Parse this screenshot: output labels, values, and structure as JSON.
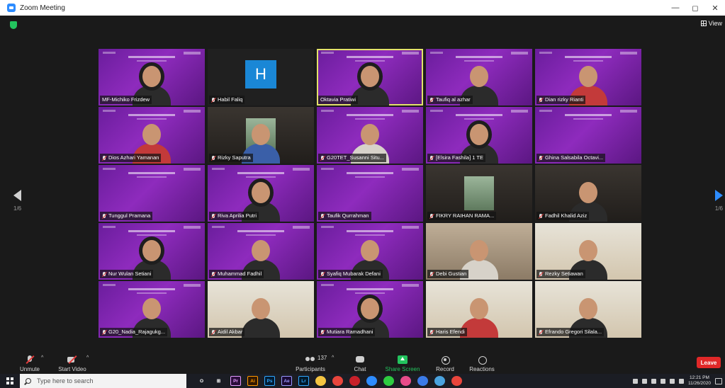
{
  "window": {
    "title": "Zoom Meeting",
    "controls": [
      "—",
      "◻",
      "✕"
    ]
  },
  "view": {
    "label": "View"
  },
  "pagination": {
    "left": "1/6",
    "right": "1/6"
  },
  "participants": [
    {
      "name": "MF-Michiko Frizdew",
      "bg": "purple",
      "person": "hijab",
      "muted": false
    },
    {
      "name": "Habil Faliq",
      "bg": "avatar",
      "avatar_letter": "H",
      "muted": true
    },
    {
      "name": "Oktavia Pratiwi",
      "bg": "purple",
      "person": "hijab",
      "muted": false,
      "speaking": true
    },
    {
      "name": "Taufiq al azhar",
      "bg": "purple",
      "person": "plain",
      "muted": true
    },
    {
      "name": "Dian rizky Rianti",
      "bg": "purple",
      "person": "red",
      "muted": true
    },
    {
      "name": "Dios Azhari Yamanan",
      "bg": "purple",
      "person": "red",
      "muted": true
    },
    {
      "name": "Rizky Saputra",
      "bg": "dark-inset",
      "person": "blue",
      "muted": true
    },
    {
      "name": "G20TET_Susanni Situ...",
      "bg": "purple",
      "person": "light",
      "muted": true
    },
    {
      "name": "[Elsira Fashila] 1 TE",
      "bg": "purple",
      "person": "hijab",
      "muted": true
    },
    {
      "name": "Ghina Salsabila Octavi...",
      "bg": "purple",
      "person": "none",
      "muted": true
    },
    {
      "name": "Tunggul Pramana",
      "bg": "purple",
      "person": "none",
      "muted": true
    },
    {
      "name": "Riva Aprilia Putri",
      "bg": "purple",
      "person": "hijab",
      "muted": true
    },
    {
      "name": "Taufik Qurrahman",
      "bg": "purple",
      "person": "none",
      "muted": true
    },
    {
      "name": "FIKRY RAIHAN RAMA...",
      "bg": "dark-inset",
      "person": "none",
      "muted": true
    },
    {
      "name": "Fadhil Khalid Aziz",
      "bg": "dark",
      "person": "plain",
      "muted": true
    },
    {
      "name": "Nur Wulan Setiani",
      "bg": "purple",
      "person": "hijab",
      "muted": true
    },
    {
      "name": "Muhammad Fadhil",
      "bg": "purple",
      "person": "plain",
      "muted": true
    },
    {
      "name": "Syafiq Mubarak Defani",
      "bg": "purple",
      "person": "plain",
      "muted": true
    },
    {
      "name": "Debi Gustian",
      "bg": "mid",
      "person": "light",
      "muted": true
    },
    {
      "name": "Rezky Setiawan",
      "bg": "room",
      "person": "plain",
      "muted": true
    },
    {
      "name": "G20_Nadia_Rajagukg...",
      "bg": "purple",
      "person": "plain",
      "muted": true
    },
    {
      "name": "Aidil Akbar",
      "bg": "room",
      "person": "plain",
      "muted": true
    },
    {
      "name": "Mutiara Ramadhani",
      "bg": "purple",
      "person": "hijab",
      "muted": true
    },
    {
      "name": "Haris Efendi",
      "bg": "room",
      "person": "red",
      "muted": true
    },
    {
      "name": "Efrando Gregori Silala...",
      "bg": "room",
      "person": "plain",
      "muted": true
    }
  ],
  "toolbar": {
    "unmute": "Unmute",
    "start_video": "Start Video",
    "participants": "Participants",
    "participants_count": "137",
    "chat": "Chat",
    "share_screen": "Share Screen",
    "record": "Record",
    "reactions": "Reactions",
    "leave": "Leave"
  },
  "taskbar": {
    "search_placeholder": "Type here to search",
    "apps": [
      {
        "name": "cortana-icon",
        "glyph": "O",
        "bg": "transparent",
        "fg": "#ffffff"
      },
      {
        "name": "task-view-icon",
        "glyph": "⊞",
        "bg": "transparent",
        "fg": "#ffffff"
      },
      {
        "name": "premiere-icon",
        "glyph": "Pr",
        "bg": "#2a0d3a",
        "fg": "#e59bff"
      },
      {
        "name": "illustrator-icon",
        "glyph": "Ai",
        "bg": "#321800",
        "fg": "#ff9a00"
      },
      {
        "name": "photoshop-icon",
        "glyph": "Ps",
        "bg": "#001c34",
        "fg": "#31a8ff"
      },
      {
        "name": "after-effects-icon",
        "glyph": "Ae",
        "bg": "#1a0a34",
        "fg": "#9999ff"
      },
      {
        "name": "lightroom-icon",
        "glyph": "Lr",
        "bg": "#001a2b",
        "fg": "#31a8ff"
      },
      {
        "name": "file-explorer-icon",
        "glyph": "",
        "bg": "#f4c542",
        "fg": "#ffffff"
      },
      {
        "name": "chrome-icon",
        "glyph": "",
        "bg": "#e8453c",
        "fg": "#ffffff"
      },
      {
        "name": "app-red-icon",
        "glyph": "",
        "bg": "#c8202a",
        "fg": "#ffffff"
      },
      {
        "name": "zoom-icon",
        "glyph": "",
        "bg": "#2d8cff",
        "fg": "#ffffff"
      },
      {
        "name": "line-icon",
        "glyph": "",
        "bg": "#2ecc40",
        "fg": "#ffffff"
      },
      {
        "name": "app-pink-icon",
        "glyph": "",
        "bg": "#e74c8a",
        "fg": "#ffffff"
      },
      {
        "name": "chrome-2-icon",
        "glyph": "",
        "bg": "#3b7be8",
        "fg": "#ffffff"
      },
      {
        "name": "app-blue-icon",
        "glyph": "",
        "bg": "#4aa3df",
        "fg": "#ffffff"
      },
      {
        "name": "chrome-badge-icon",
        "glyph": "",
        "bg": "#e8453c",
        "fg": "#ffffff"
      }
    ],
    "time": "12:21 PM",
    "date": "11/26/2020"
  },
  "colors": {
    "accent": "#2d8cff",
    "leave": "#e02828",
    "speaking": "#e3e16b",
    "share": "#23c45e"
  }
}
